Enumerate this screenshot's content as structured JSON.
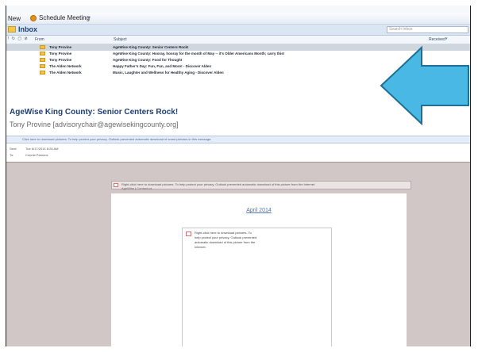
{
  "toolbar": {
    "new_label": "New",
    "meeting_label": "Schedule Meeting"
  },
  "inbox": {
    "title": "Inbox",
    "search_placeholder": "Search Inbox"
  },
  "columns": {
    "from": "From",
    "subject": "Subject",
    "received": "Received"
  },
  "messages": [
    {
      "from": "Tony Provine",
      "subject": "AgeWise King County: Senior Centers Rock!"
    },
    {
      "from": "Tony Provine",
      "subject": "AgeWise King County: Hooray, hooray for the month of May -- it's Older Americans Month; carry this!"
    },
    {
      "from": "Tony Provine",
      "subject": "AgeWise King County: Food for Thought"
    },
    {
      "from": "The Alden Network",
      "subject": "Happy Father's Day: Fun, Fun, and More! - Discover Alden"
    },
    {
      "from": "The Alden Network",
      "subject": "Music, Laughter and Wellness for Healthy Aging - Discover Alden"
    }
  ],
  "reading": {
    "title": "AgeWise King County: Senior Centers Rock!",
    "from": "Tony Provine [advisorychair@agewisekingcounty.org]",
    "info_bar": "Click here to download pictures. To help protect your privacy, Outlook prevented automatic download of some pictures in this message.",
    "sent_label": "Sent:",
    "sent_value": "Tue 6/17/2014 8:26 AM",
    "to_label": "To:",
    "to_value": "Connie Parsons"
  },
  "body": {
    "warning_top": "Right-click here to download pictures. To help protect your privacy, Outlook prevented automatic download of this picture from the Internet.",
    "warning_top_sub": "AgeWise | Contact us",
    "month": "April 2014",
    "warning_box": "Right-click here to download pictures. To help protect your privacy, Outlook prevented automatic download of this picture from the Internet."
  },
  "colors": {
    "arrow_fill": "#4ab8e4",
    "arrow_stroke": "#1e6f94",
    "body_background": "#d1c7c7",
    "selected_row": "#cfd6de"
  }
}
